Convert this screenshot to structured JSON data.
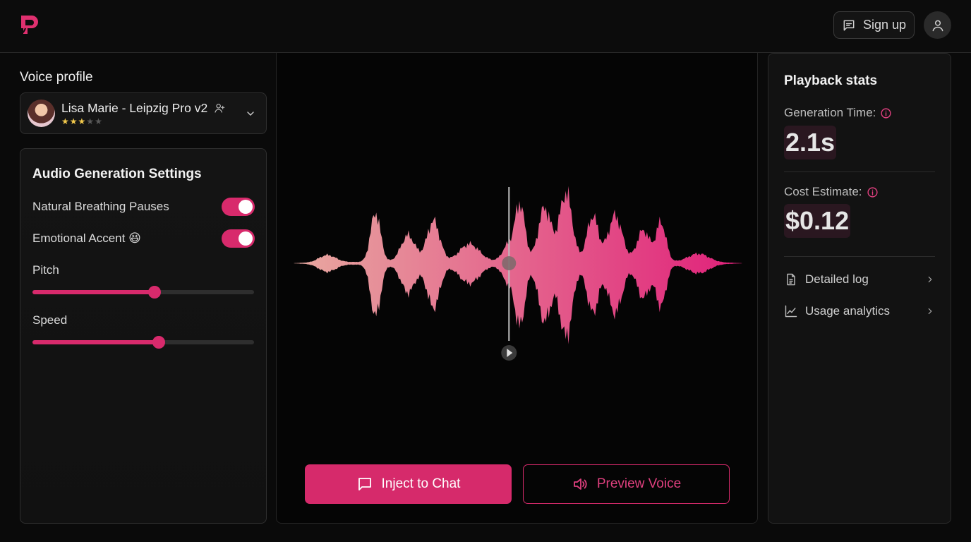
{
  "header": {
    "logo_icon": "brand-logo-icon",
    "signup_label": "Sign up",
    "signup_icon": "message-square-icon",
    "profile_icon": "user-icon"
  },
  "voice_profile": {
    "title": "Voice profile",
    "selected_name": "Lisa Marie - Leipzig Pro v2",
    "rating": 3,
    "rating_max": 5
  },
  "settings": {
    "title": "Audio Generation Settings",
    "toggles": [
      {
        "label": "Natural Breathing Pauses",
        "on": true
      },
      {
        "label": "Emotional Accent 😆",
        "on": true
      }
    ],
    "sliders": [
      {
        "label": "Pitch",
        "value": 0.55
      },
      {
        "label": "Speed",
        "value": 0.57
      }
    ]
  },
  "player": {
    "playhead_position": 0.48,
    "inject_label": "Inject to Chat",
    "preview_label": "Preview Voice"
  },
  "stats": {
    "title": "Playback stats",
    "generation_time_label": "Generation Time:",
    "generation_time_value": "2.1s",
    "cost_label": "Cost Estimate:",
    "cost_value": "$0.12",
    "links": [
      {
        "label": "Detailed log",
        "icon": "file-text-icon"
      },
      {
        "label": "Usage analytics",
        "icon": "line-chart-icon"
      }
    ]
  },
  "colors": {
    "accent": "#d82a6c",
    "wave_start": "#e8a9a0",
    "wave_end": "#e0207a",
    "background": "#0a0a0a"
  }
}
